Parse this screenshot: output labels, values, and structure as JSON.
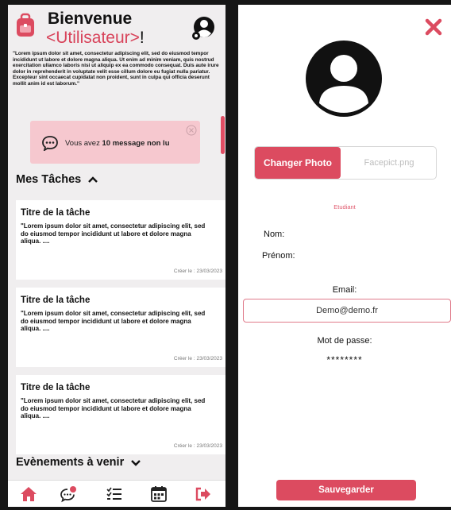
{
  "colors": {
    "accent": "#dc4b60",
    "message_bg": "#f6c8cf",
    "background": "#161616"
  },
  "header": {
    "welcome": "Bienvenue",
    "user_name": "<Utilisateur>",
    "exclamation": "!",
    "intro": "\"Lorem ipsum dolor sit amet, consectetur adipiscing elit, sed do eiusmod tempor incididunt ut labore et dolore magna aliqua. Ut enim ad minim veniam, quis nostrud exercitation ullamco laboris nisi ut aliquip ex ea commodo consequat. Duis aute irure dolor in reprehenderit in voluptate velit esse cillum dolore eu fugiat nulla pariatur. Excepteur sint occaecat cupidatat non proident, sunt in culpa qui officia deserunt mollit anim id est laborum.\""
  },
  "messages": {
    "prefix": "Vous avez",
    "count": "10",
    "suffix": "message non lu"
  },
  "tasks_section": {
    "title": "Mes Tâches",
    "icon": "chevron-up-icon"
  },
  "tasks": [
    {
      "title": "Titre de la tâche",
      "description": "\"Lorem ipsum dolor sit amet, consectetur adipiscing elit, sed do eiusmod tempor incididunt ut labore et dolore magna aliqua. ....",
      "date": "Créer le : 23/03/2023"
    },
    {
      "title": "Titre de la tâche",
      "description": "\"Lorem ipsum dolor sit amet, consectetur adipiscing elit, sed do eiusmod tempor incididunt ut labore et dolore magna aliqua. ....",
      "date": "Créer le : 23/03/2023"
    },
    {
      "title": "Titre de la tâche",
      "description": "\"Lorem ipsum dolor sit amet, consectetur adipiscing elit, sed do eiusmod tempor incididunt ut labore et dolore magna aliqua. ....",
      "date": "Créer le : 23/03/2023"
    }
  ],
  "events_section": {
    "title": "Evènements à venir",
    "icon": "chevron-down-icon"
  },
  "nav": [
    "home-icon",
    "chat-notification-icon",
    "task-list-icon",
    "calendar-icon",
    "logout-icon"
  ],
  "profile": {
    "change_photo": "Changer Photo",
    "file_name": "Facepict.png",
    "role": "Etudiant",
    "nom_label": "Nom:",
    "prenom_label": "Prénom:",
    "email_label": "Email:",
    "email_value": "Demo@demo.fr",
    "password_label": "Mot de passe:",
    "password_value": "********",
    "save": "Sauvegarder"
  }
}
